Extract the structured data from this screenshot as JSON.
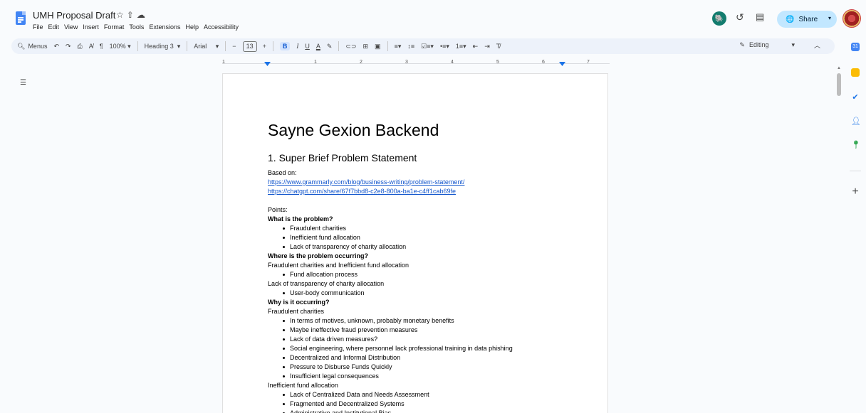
{
  "title": "UMH Proposal Draft",
  "title_icons": [
    "star-icon",
    "move-icon",
    "cloud-icon"
  ],
  "menu": [
    "File",
    "Edit",
    "View",
    "Insert",
    "Format",
    "Tools",
    "Extensions",
    "Help",
    "Accessibility"
  ],
  "share_label": "Share",
  "toolbar": {
    "menus_label": "Menus",
    "zoom": "100%",
    "style": "Heading 3",
    "font": "Arial",
    "font_size": "13",
    "bold": "B",
    "italic": "I",
    "underline": "U",
    "text_color": "A",
    "editing_label": "Editing"
  },
  "ruler_numbers": [
    "1",
    "1",
    "2",
    "3",
    "4",
    "5",
    "6",
    "7"
  ],
  "doc": {
    "heading": "Sayne Gexion Backend",
    "section_title": "1. Super Brief Problem Statement",
    "lines": [
      {
        "type": "text",
        "text": "Based on:"
      },
      {
        "type": "link",
        "text": "https://www.grammarly.com/blog/business-writing/problem-statement/"
      },
      {
        "type": "link",
        "text": "https://chatgpt.com/share/67f7bbd8-c2e8-800a-ba1e-c4ff1cab69fe"
      },
      {
        "type": "gap",
        "text": ""
      },
      {
        "type": "text",
        "text": "Points:"
      },
      {
        "type": "bold",
        "text": "What is the problem?"
      },
      {
        "type": "bullet",
        "text": "Fraudulent charities"
      },
      {
        "type": "bullet",
        "text": "Inefficient fund allocation"
      },
      {
        "type": "bullet",
        "text": "Lack of transparency of charity allocation"
      },
      {
        "type": "bold",
        "text": "Where is the problem occurring?"
      },
      {
        "type": "text",
        "text": "Fraudulent charities and Inefficient fund allocation"
      },
      {
        "type": "bullet",
        "text": "Fund allocation process"
      },
      {
        "type": "text",
        "text": "Lack of transparency of charity allocation"
      },
      {
        "type": "bullet",
        "text": "User-body communication"
      },
      {
        "type": "bold",
        "text": "Why is it occurring?"
      },
      {
        "type": "text",
        "text": "Fraudulent charities"
      },
      {
        "type": "bullet",
        "text": "In terms of motives, unknown, probably monetary benefits"
      },
      {
        "type": "bullet",
        "text": "Maybe ineffective fraud prevention measures"
      },
      {
        "type": "bullet",
        "text": "Lack of data driven measures?"
      },
      {
        "type": "bullet",
        "text": "Social engineering, where personnel lack professional training in data phishing"
      },
      {
        "type": "bullet",
        "text": "Decentralized and Informal Distribution"
      },
      {
        "type": "bullet",
        "text": "Pressure to Disburse Funds Quickly"
      },
      {
        "type": "bullet",
        "text": "Insufficient legal consequences"
      },
      {
        "type": "text",
        "text": "Inefficient fund allocation"
      },
      {
        "type": "bullet",
        "text": "Lack of Centralized Data and Needs Assessment"
      },
      {
        "type": "bullet",
        "text": "Fragmented and Decentralized Systems"
      },
      {
        "type": "bullet",
        "text": "Administrative and Institutional Bias"
      }
    ]
  },
  "colors": {
    "accent": "#0b57d0",
    "share_bg": "#c2e7ff",
    "toolbar_bg": "#edf2fa",
    "link": "#1155cc"
  }
}
